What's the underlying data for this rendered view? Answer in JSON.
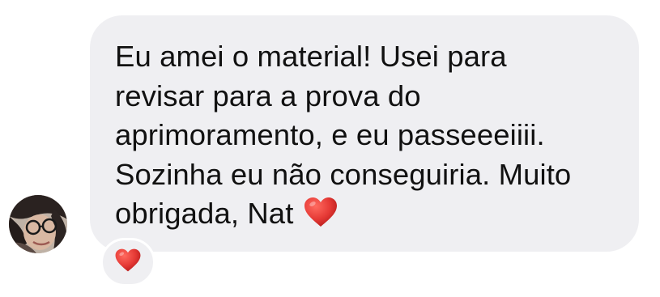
{
  "message": {
    "lines": [
      "Eu amei o material! Usei para",
      "revisar para a prova do",
      "aprimoramento, e eu passeeeiiii.",
      "Sozinha eu não conseguiria. Muito",
      "obrigada, Nat"
    ],
    "inline_emoji": "heart-icon",
    "bubble_color": "#efeff2",
    "text_color": "#111111"
  },
  "reaction": {
    "emoji": "heart-icon",
    "color": "#e53935"
  },
  "sender": {
    "avatar": "avatar"
  }
}
